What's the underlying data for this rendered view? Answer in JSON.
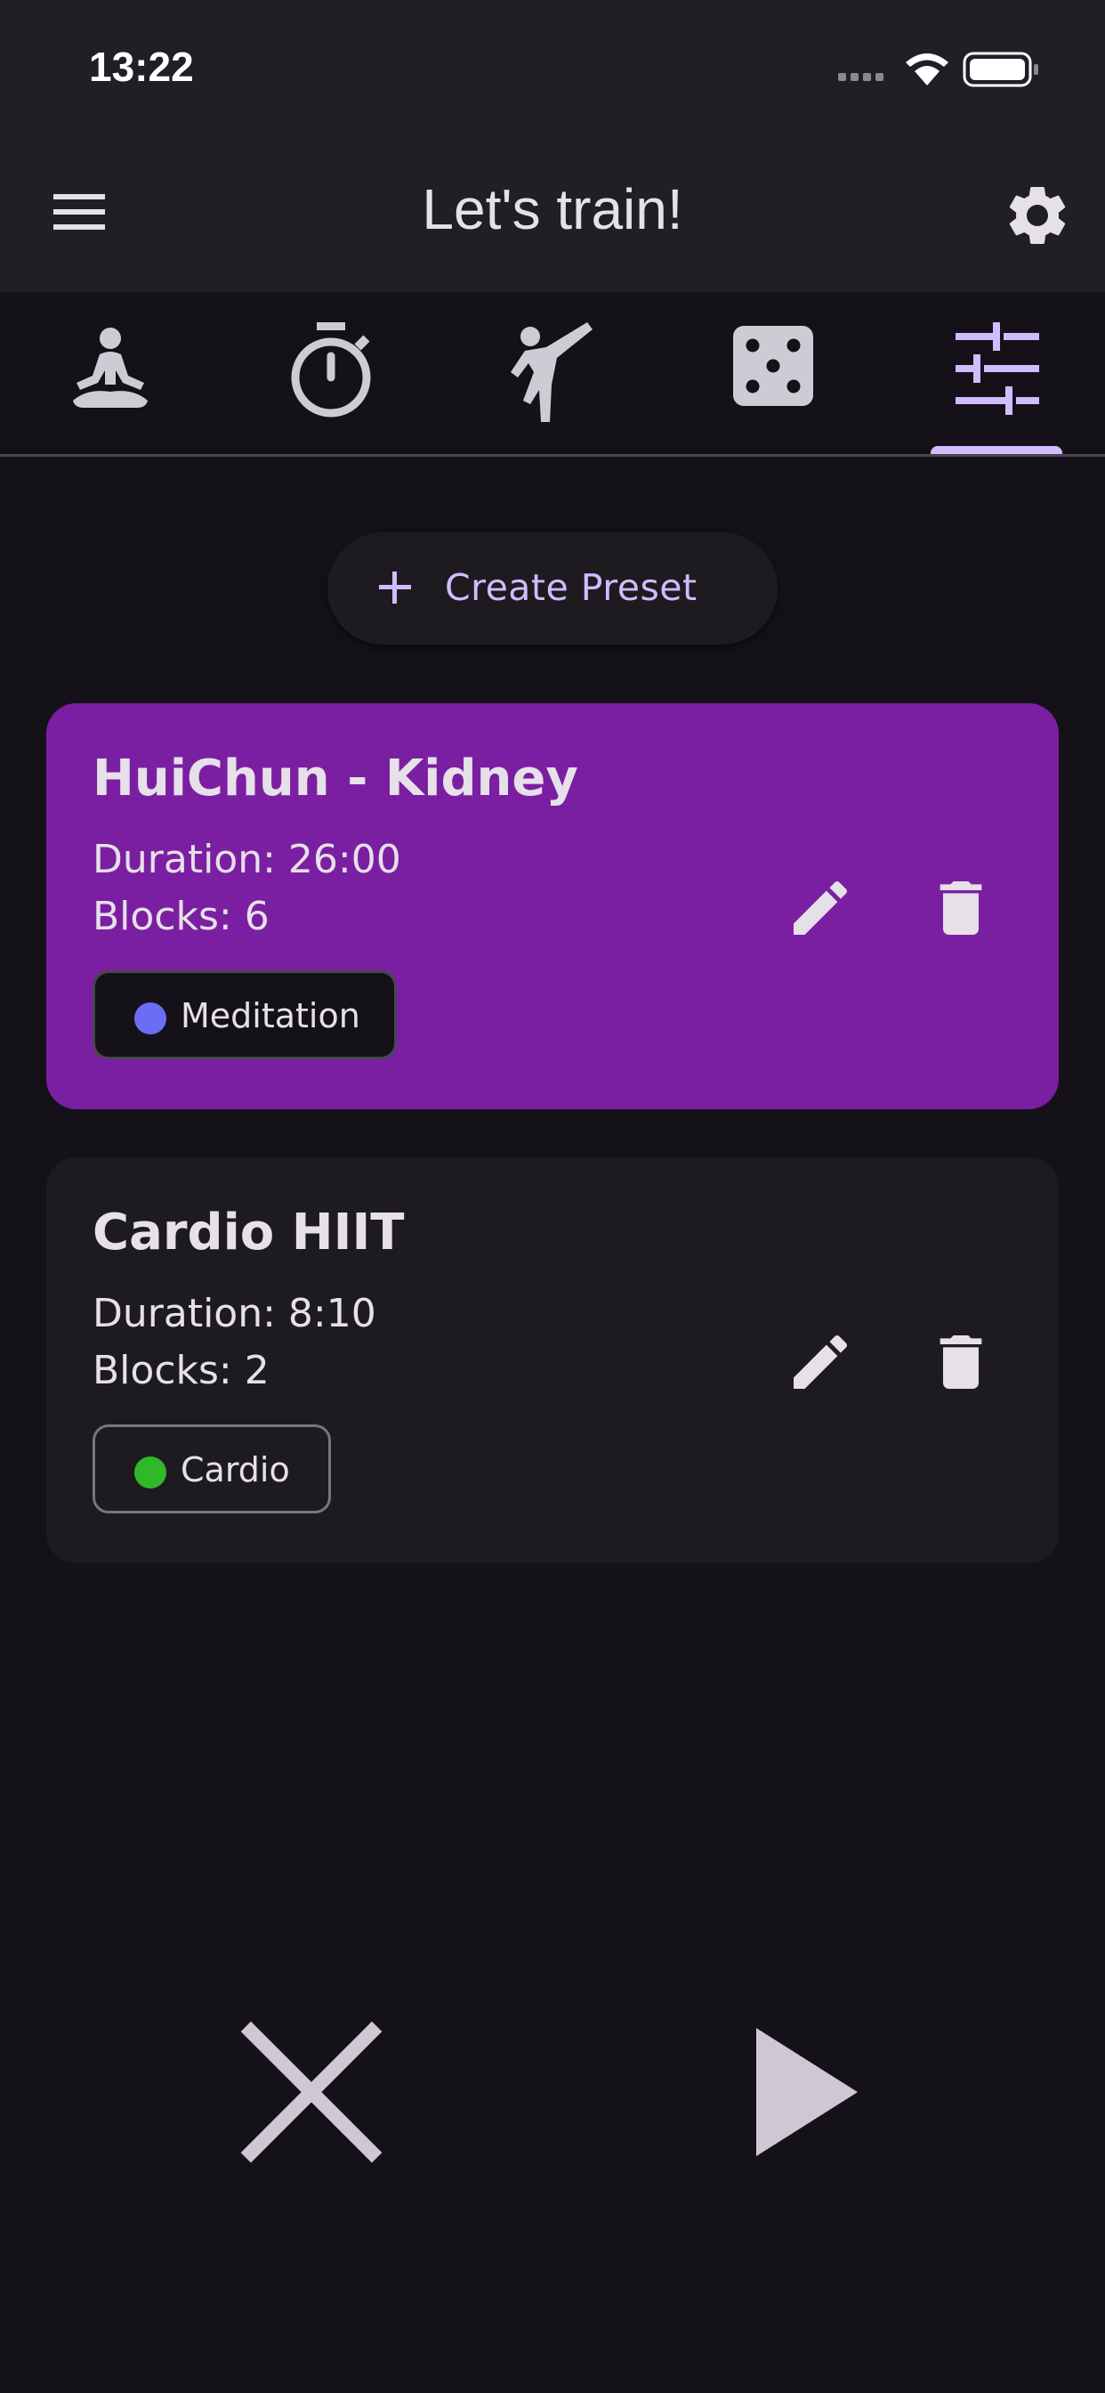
{
  "status_bar": {
    "time": "13:22"
  },
  "app_bar": {
    "title": "Let's train!"
  },
  "tabs": [
    {
      "icon": "meditation-icon"
    },
    {
      "icon": "stopwatch-icon"
    },
    {
      "icon": "martial-arts-icon"
    },
    {
      "icon": "dice-icon"
    },
    {
      "icon": "tune-sliders-icon",
      "selected": true
    }
  ],
  "create_preset": {
    "label": "Create Preset"
  },
  "presets": [
    {
      "title": "HuiChun - Kidney",
      "duration": "Duration: 26:00",
      "blocks": "Blocks: 6",
      "tag": "Meditation",
      "tag_color": "#6b6ef5",
      "selected": true
    },
    {
      "title": "Cardio HIIT",
      "duration": "Duration: 8:10",
      "blocks": "Blocks: 2",
      "tag": "Cardio",
      "tag_color": "#2fb829",
      "selected": false
    }
  ],
  "colors": {
    "background": "#141218",
    "app_bar": "#211f26",
    "accent": "#d0bcff",
    "selected_card": "#7b1fa2",
    "card": "#1d1b20"
  }
}
